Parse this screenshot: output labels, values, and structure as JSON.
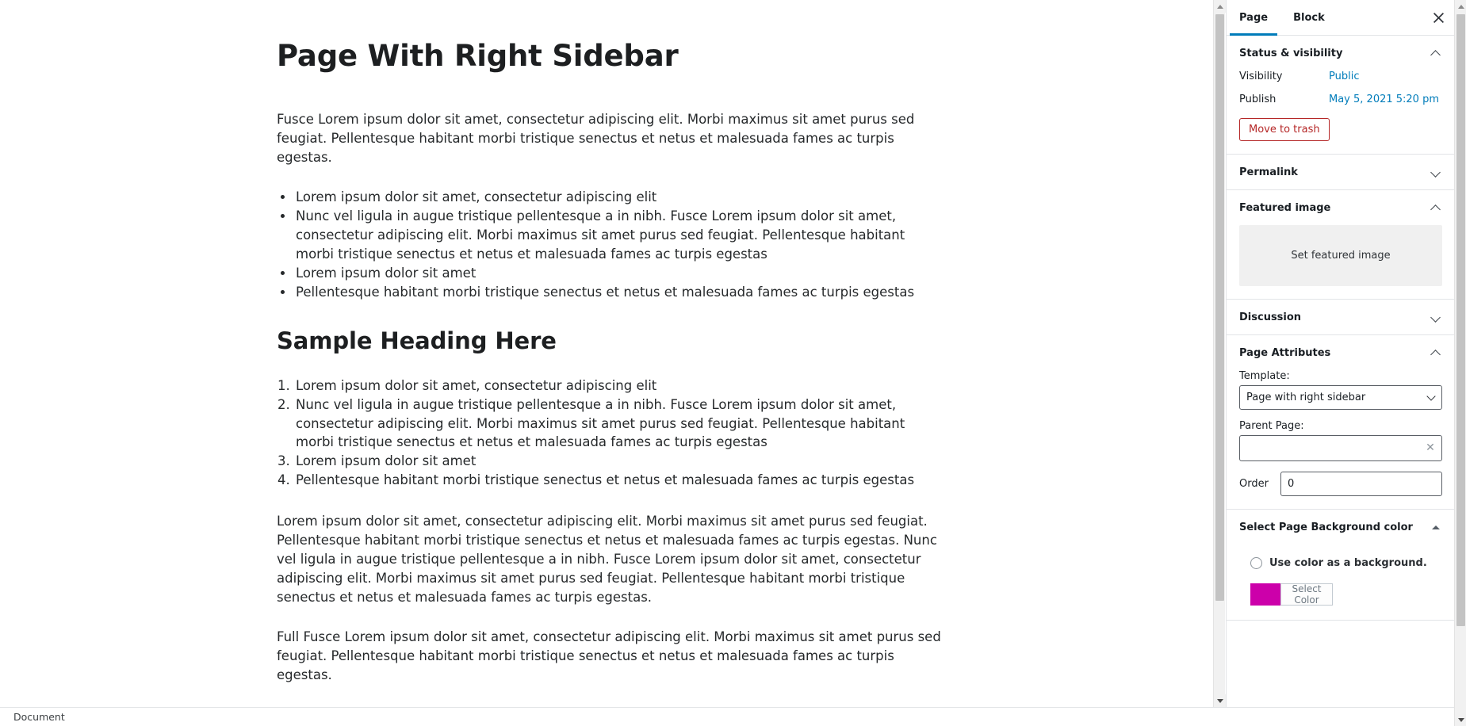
{
  "document": {
    "title": "Page With Right Sidebar",
    "blocks": [
      {
        "type": "paragraph",
        "text": "Fusce Lorem ipsum dolor sit amet, consectetur adipiscing elit. Morbi maximus sit amet purus sed feugiat. Pellentesque habitant morbi tristique senectus et netus et malesuada fames ac turpis egestas."
      },
      {
        "type": "bulleted-list",
        "items": [
          "Lorem ipsum dolor sit amet, consectetur adipiscing elit",
          "Nunc vel ligula in augue tristique pellentesque a in nibh. Fusce Lorem ipsum dolor sit amet, consectetur adipiscing elit. Morbi maximus sit amet purus sed feugiat. Pellentesque habitant morbi tristique senectus et netus et malesuada fames ac turpis egestas",
          "Lorem ipsum dolor sit amet",
          "Pellentesque habitant morbi tristique senectus et netus et malesuada fames ac turpis egestas"
        ]
      },
      {
        "type": "heading",
        "text": "Sample Heading Here"
      },
      {
        "type": "numbered-list",
        "items": [
          "Lorem ipsum dolor sit amet, consectetur adipiscing elit",
          "Nunc vel ligula in augue tristique pellentesque a in nibh. Fusce Lorem ipsum dolor sit amet, consectetur adipiscing elit. Morbi maximus sit amet purus sed feugiat. Pellentesque habitant morbi tristique senectus et netus et malesuada fames ac turpis egestas",
          "Lorem ipsum dolor sit amet",
          "Pellentesque habitant morbi tristique senectus et netus et malesuada fames ac turpis egestas"
        ]
      },
      {
        "type": "paragraph",
        "text": "Lorem ipsum dolor sit amet, consectetur adipiscing elit. Morbi maximus sit amet purus sed feugiat. Pellentesque habitant morbi tristique senectus et netus et malesuada fames ac turpis egestas. Nunc vel ligula in augue tristique pellentesque a in nibh. Fusce Lorem ipsum dolor sit amet, consectetur adipiscing elit. Morbi maximus sit amet purus sed feugiat. Pellentesque habitant morbi tristique senectus et netus et malesuada fames ac turpis egestas."
      },
      {
        "type": "paragraph",
        "text": "Full Fusce Lorem ipsum dolor sit amet, consectetur adipiscing elit. Morbi maximus sit amet purus sed feugiat. Pellentesque habitant morbi tristique senectus et netus et malesuada fames ac turpis egestas."
      }
    ]
  },
  "sidebar": {
    "tabs": [
      {
        "label": "Page",
        "active": true
      },
      {
        "label": "Block",
        "active": false
      }
    ],
    "close_icon": "close-icon",
    "status_visibility": {
      "title": "Status & visibility",
      "expanded": true,
      "visibility_label": "Visibility",
      "visibility_value": "Public",
      "publish_label": "Publish",
      "publish_value": "May 5, 2021 5:20 pm",
      "trash_label": "Move to trash"
    },
    "permalink": {
      "title": "Permalink",
      "expanded": false
    },
    "featured_image": {
      "title": "Featured image",
      "expanded": true,
      "placeholder_label": "Set featured image"
    },
    "discussion": {
      "title": "Discussion",
      "expanded": false
    },
    "page_attributes": {
      "title": "Page Attributes",
      "expanded": true,
      "template_label": "Template:",
      "template_value": "Page with right sidebar",
      "template_options": [
        "Page with right sidebar"
      ],
      "parent_label": "Parent Page:",
      "parent_value": "",
      "parent_clear_icon": "clear-icon",
      "order_label": "Order",
      "order_value": "0"
    },
    "background_color": {
      "title": "Select Page Background color",
      "expanded": true,
      "checkbox_label": "Use color as a background.",
      "checkbox_checked": false,
      "swatch_color": "#cc00aa",
      "select_color_label": "Select Color"
    }
  },
  "statusbar": {
    "breadcrumb": "Document"
  },
  "theme": {
    "accent": "#007cba",
    "link": "#007cba",
    "danger": "#b52727",
    "border": "#e2e4e7",
    "text": "#191e23"
  }
}
